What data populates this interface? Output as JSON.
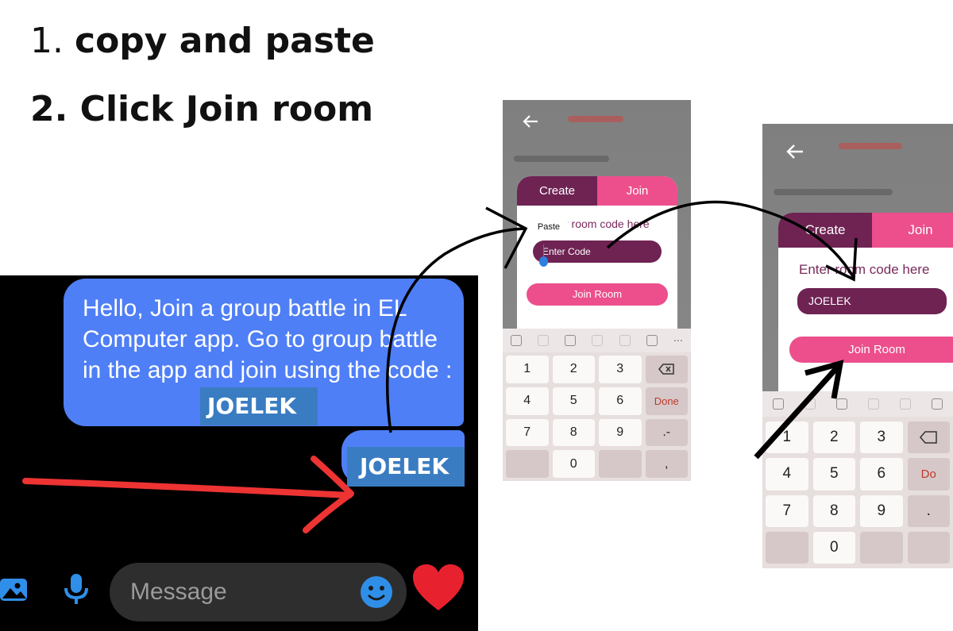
{
  "instructions": {
    "step1_number": "1.",
    "step1_text": "copy and paste",
    "step2": "2. Click Join room"
  },
  "chat": {
    "message_text": "Hello, Join a group battle in EL Computer app. Go to group battle in the app and join using the code :",
    "message_code": "JOELEK",
    "sent_code": "JOELEK",
    "input_placeholder": "Message",
    "colors": {
      "bubble": "#4f7ff6",
      "highlight": "#3a7cc2",
      "annotation_arrow": "#ee3333"
    }
  },
  "phone1": {
    "tab_create": "Create",
    "tab_join": "Join",
    "hint": "r room code here",
    "paste_label": "Paste",
    "input_placeholder": "Enter Code",
    "join_button": "Join Room",
    "keys": [
      "1",
      "2",
      "3",
      "",
      "4",
      "5",
      "6",
      "Done",
      "7",
      "8",
      "9",
      ".-",
      "",
      "0",
      "",
      ","
    ]
  },
  "phone2": {
    "tab_create": "Create",
    "tab_join": "Join",
    "hint": "Enter room code here",
    "input_value": "JOELEK",
    "join_button": "Join Room",
    "keys": [
      "1",
      "2",
      "3",
      "",
      "4",
      "5",
      "6",
      "Do",
      "7",
      "8",
      "9",
      ".",
      "",
      "0",
      "",
      ""
    ]
  },
  "colors": {
    "brand_dark": "#6e2353",
    "brand_pink": "#ec4f8b",
    "done_key": "#c0392b"
  }
}
